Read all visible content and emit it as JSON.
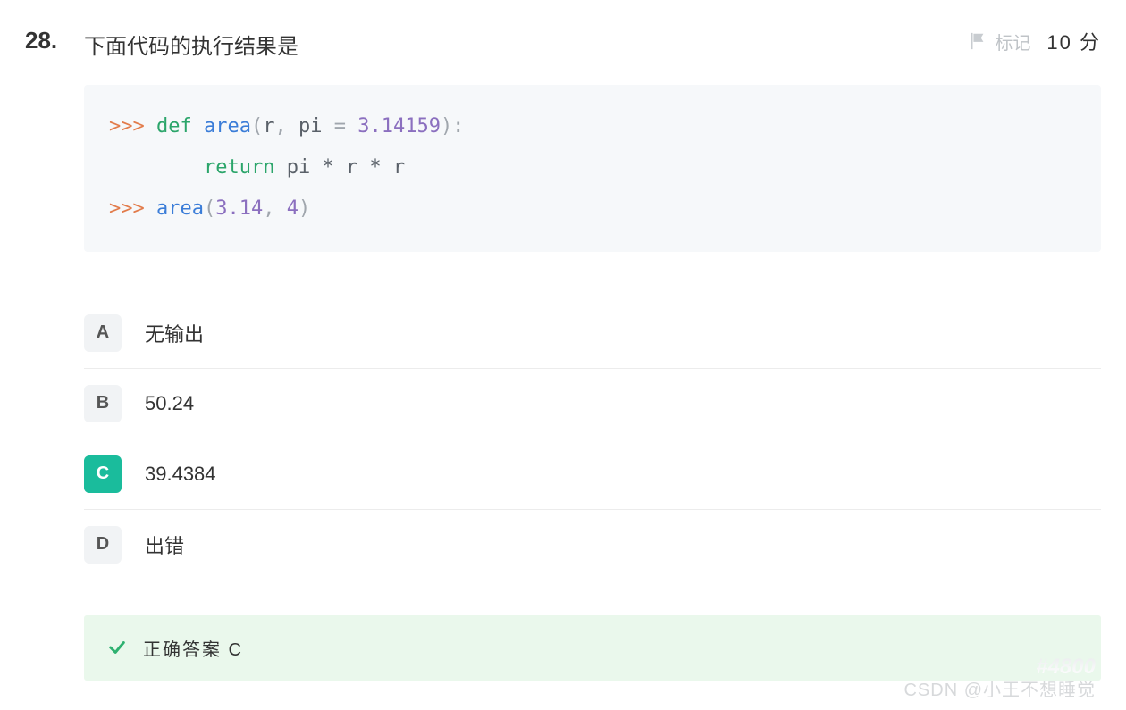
{
  "question": {
    "number": "28.",
    "text": "下面代码的执行结果是",
    "mark_label": "标记",
    "points": "10 分"
  },
  "code": {
    "prompt1": ">>> ",
    "kw_def": "def",
    "fn_name": "area",
    "p_open": "(",
    "arg_r": "r",
    "comma": ", ",
    "arg_pi": "pi ",
    "eq": "= ",
    "num_pi": "3.14159",
    "p_close": "):",
    "indent": "        ",
    "kw_return": "return",
    "ret_expr": " pi * r * r",
    "prompt2": ">>> ",
    "call_fn": "area",
    "call_open": "(",
    "call_a1": "3.14",
    "call_comma": ", ",
    "call_a2": "4",
    "call_close": ")"
  },
  "choices": [
    {
      "letter": "A",
      "text": "无输出",
      "selected": false
    },
    {
      "letter": "B",
      "text": "50.24",
      "selected": false
    },
    {
      "letter": "C",
      "text": "39.4384",
      "selected": true
    },
    {
      "letter": "D",
      "text": "出错",
      "selected": false
    }
  ],
  "answer": {
    "label": "正确答案 C"
  },
  "watermark": {
    "code": "#4800",
    "credit": "CSDN @小王不想睡觉"
  }
}
